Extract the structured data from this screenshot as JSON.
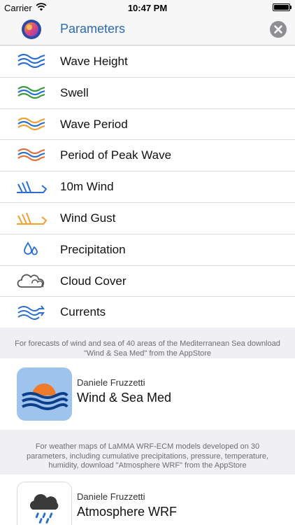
{
  "status_bar": {
    "carrier": "Carrier",
    "time": "10:47 PM",
    "battery_level": 1.0
  },
  "nav": {
    "title": "Parameters",
    "app_icon": "app-logo-icon",
    "close_icon": "close-circle-icon"
  },
  "parameters": [
    {
      "label": "Wave Height",
      "icon": "wave-height-icon",
      "color": "#2a6fd0"
    },
    {
      "label": "Swell",
      "icon": "swell-icon",
      "color": "#3a9a3a"
    },
    {
      "label": "Wave Period",
      "icon": "wave-period-icon",
      "color": "#f0a030"
    },
    {
      "label": "Period of Peak Wave",
      "icon": "peak-wave-icon",
      "color": "#e0703a"
    },
    {
      "label": "10m Wind",
      "icon": "wind-icon",
      "color": "#2a6fd0"
    },
    {
      "label": "Wind Gust",
      "icon": "wind-gust-icon",
      "color": "#f0a030"
    },
    {
      "label": "Precipitation",
      "icon": "raindrop-icon",
      "color": "#2a6fd0"
    },
    {
      "label": "Cloud Cover",
      "icon": "cloud-icon",
      "color": "#555555"
    },
    {
      "label": "Currents",
      "icon": "currents-icon",
      "color": "#2a6fd0"
    }
  ],
  "promos": [
    {
      "text": "For forecasts of wind and sea of 40 areas of the Mediterranean Sea download \"Wind & Sea Med\" from the AppStore",
      "developer": "Daniele Fruzzetti",
      "app_name": "Wind & Sea Med",
      "icon": "wind-sea-med-app-icon"
    },
    {
      "text": "For weather maps of LaMMA WRF-ECM models developed on 30 parameters, including cumulative precipitations, pressure, temperature, humidity, download \"Atmosphere WRF\" from the AppStore",
      "developer": "Daniele Fruzzetti",
      "app_name": "Atmosphere WRF",
      "icon": "atmosphere-wrf-app-icon"
    }
  ]
}
